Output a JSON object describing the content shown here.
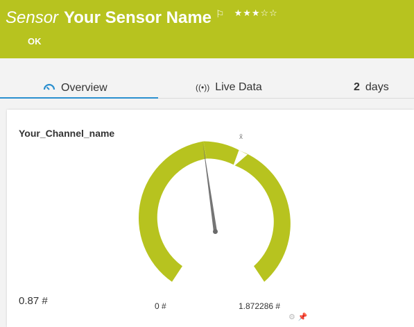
{
  "header": {
    "kind": "Sensor",
    "name": "Your Sensor Name",
    "status": "OK",
    "priority_stars": "★★★☆☆",
    "flag_icon": "flag-icon",
    "background": "#b7c31f"
  },
  "tabs": [
    {
      "label": "Overview",
      "icon": "gauge-icon",
      "active": true
    },
    {
      "label": "Live Data",
      "icon": "broadcast-icon",
      "active": false
    }
  ],
  "range": {
    "number": "2",
    "unit": "days"
  },
  "gauge": {
    "channel": "Your_Channel_name",
    "current_value": "0.87 #",
    "min_label": "0 #",
    "max_label": "1.872286 #",
    "mean_marker": "x̄",
    "value": 0.87,
    "min": 0,
    "max": 1.872286,
    "color": "#b7c31f"
  }
}
